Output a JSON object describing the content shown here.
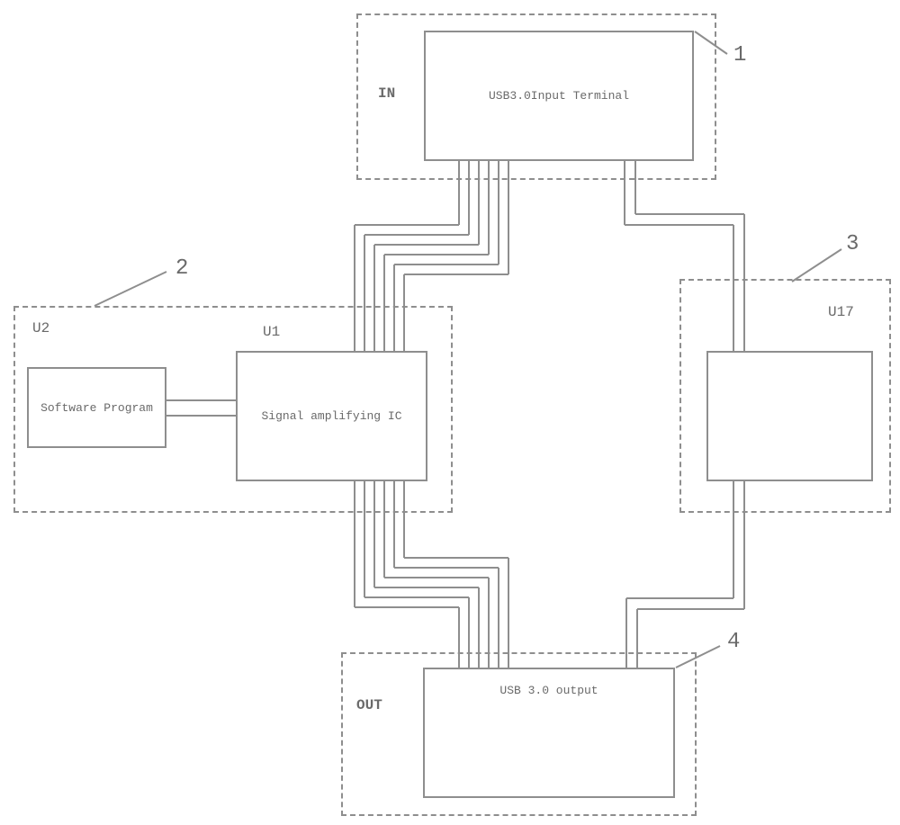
{
  "diagram": {
    "block1": {
      "ref_number": "1",
      "port_label": "IN",
      "component_text": "USB3.0Input Terminal"
    },
    "block2": {
      "ref_number": "2",
      "component_u1_label": "U1",
      "component_u1_text": "Signal amplifying IC",
      "component_u2_label": "U2",
      "component_u2_text": "Software Program"
    },
    "block3": {
      "ref_number": "3",
      "component_label": "U17"
    },
    "block4": {
      "ref_number": "4",
      "port_label": "OUT",
      "component_text": "USB 3.0 output"
    }
  }
}
